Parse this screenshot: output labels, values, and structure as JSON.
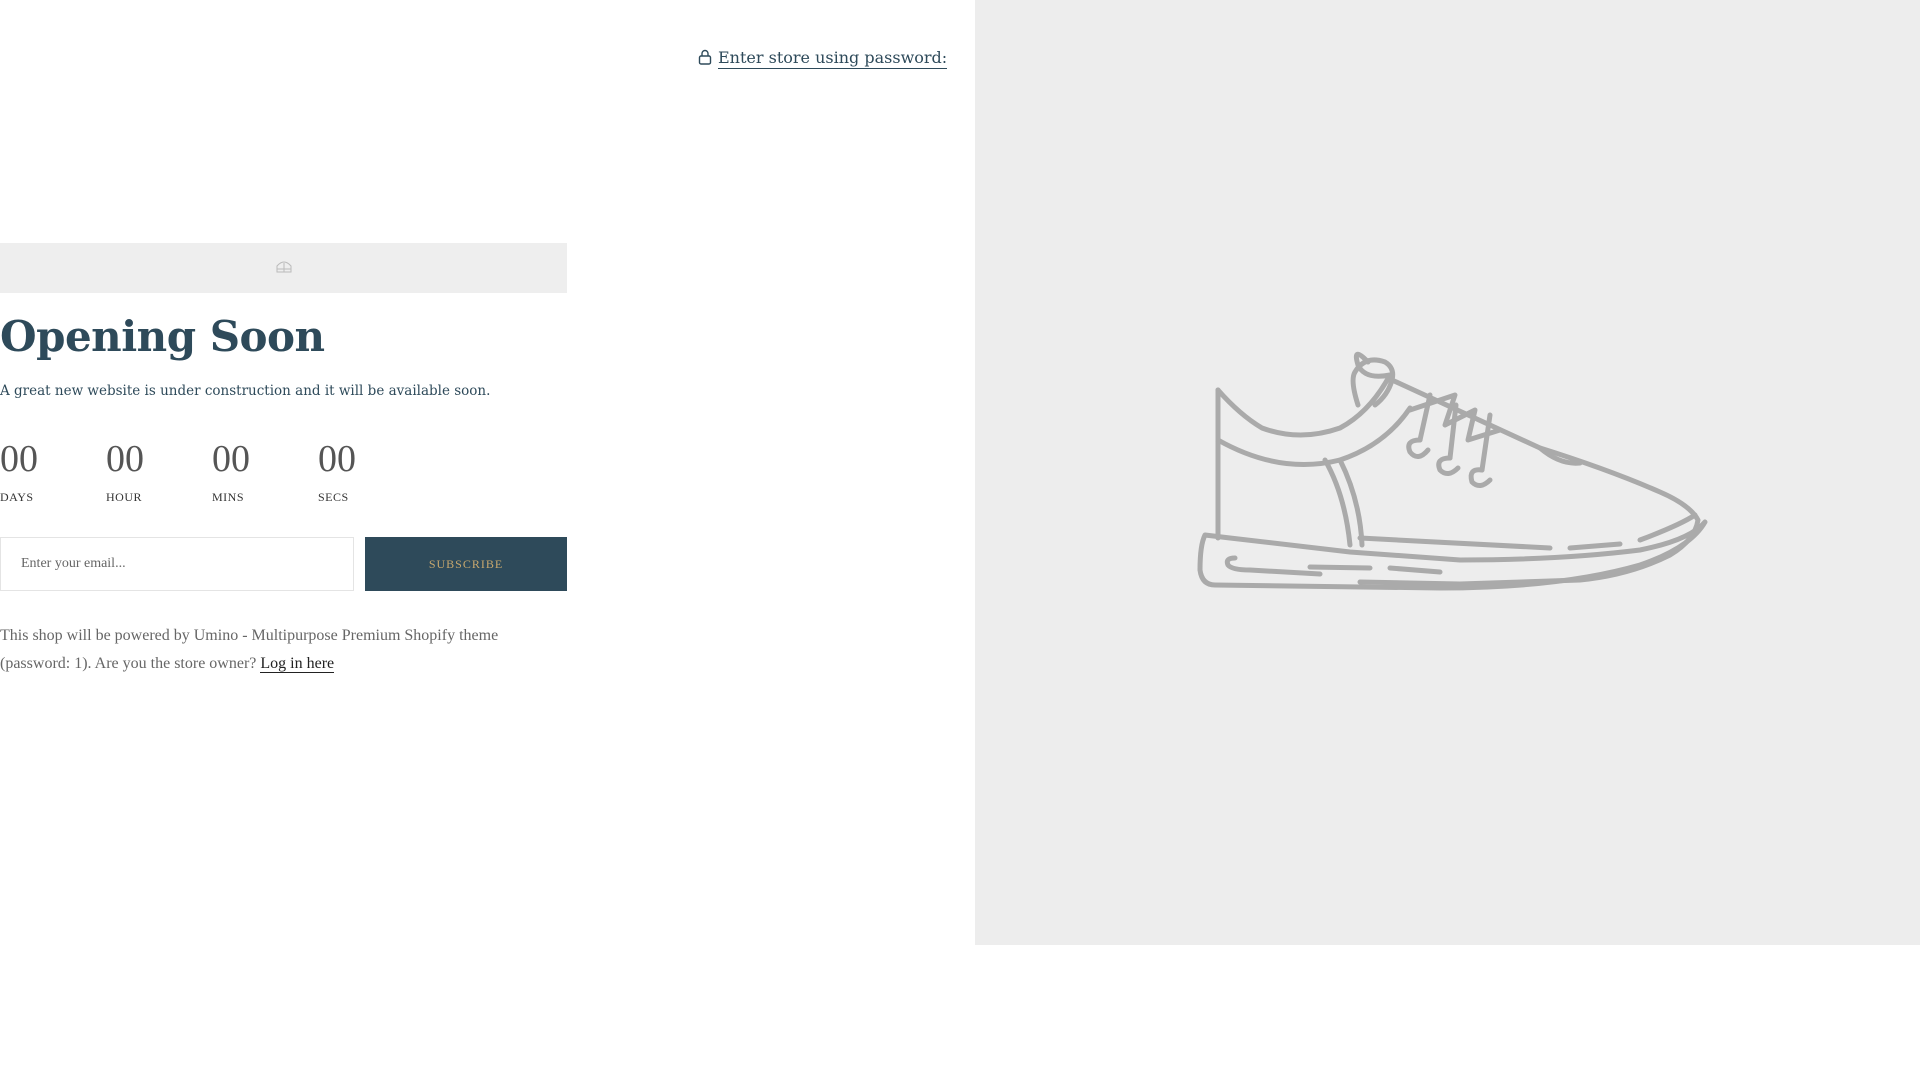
{
  "header": {
    "password_link_label": "Enter store using password:",
    "lock_icon": "lock-icon"
  },
  "logo": {
    "icon": "logo-placeholder-icon"
  },
  "main": {
    "title": "Opening Soon",
    "subtitle": "A great new website is under construction and it will be available soon."
  },
  "countdown": [
    {
      "value": "00",
      "label": "DAYS"
    },
    {
      "value": "00",
      "label": "HOUR"
    },
    {
      "value": "00",
      "label": "MINS"
    },
    {
      "value": "00",
      "label": "SECS"
    }
  ],
  "newsletter": {
    "placeholder": "Enter your email...",
    "value": "",
    "button_label": "SUBSCRIBE"
  },
  "footer": {
    "text": "This shop will be powered by Umino - Multipurpose Premium Shopify theme (password: 1). Are you the store owner?",
    "login_label": "Log in here"
  },
  "image": {
    "icon": "sneaker-illustration"
  },
  "colors": {
    "primary": "#2e4a5a",
    "button_text": "#c8a86e",
    "panel_bg": "#ededed",
    "logo_bar_bg": "#eeeeee",
    "illustration_stroke": "#aaaaaa"
  }
}
